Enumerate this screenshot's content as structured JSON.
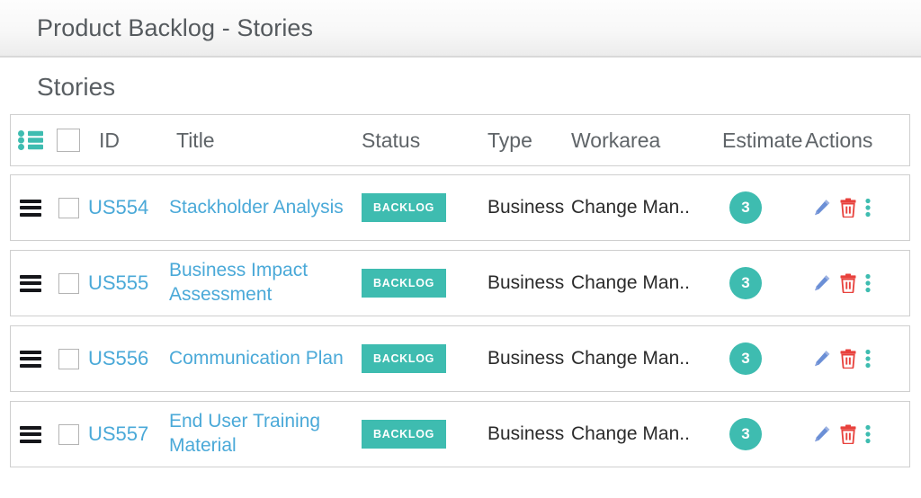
{
  "window": {
    "title": "Product Backlog - Stories"
  },
  "page": {
    "heading": "Stories"
  },
  "icons": {
    "list_icon": "list-icon",
    "drag_handle": "drag-handle-icon",
    "checkbox": "checkbox-icon",
    "edit": "pencil-icon",
    "delete": "trash-icon",
    "more": "more-vertical-icon"
  },
  "colors": {
    "accent_teal": "#3ebcb0",
    "link_blue": "#4aa9d8",
    "delete_red": "#e8413c",
    "edit_blue": "#6b8fd6",
    "header_text": "#5f6468",
    "border": "#cfcfcf"
  },
  "table": {
    "columns": {
      "id": "ID",
      "title": "Title",
      "status": "Status",
      "type": "Type",
      "workarea": "Workarea",
      "estimate": "Estimate",
      "actions": "Actions"
    },
    "select_all_checked": false,
    "rows": [
      {
        "id": "US554",
        "title": "Stackholder Analysis",
        "status": "BACKLOG",
        "type": "Business",
        "workarea": "Change Man..",
        "estimate": "3",
        "checked": false
      },
      {
        "id": "US555",
        "title": "Business Impact Assessment",
        "status": "BACKLOG",
        "type": "Business",
        "workarea": "Change Man..",
        "estimate": "3",
        "checked": false
      },
      {
        "id": "US556",
        "title": "Communication Plan",
        "status": "BACKLOG",
        "type": "Business",
        "workarea": "Change Man..",
        "estimate": "3",
        "checked": false
      },
      {
        "id": "US557",
        "title": "End User Training Material",
        "status": "BACKLOG",
        "type": "Business",
        "workarea": "Change Man..",
        "estimate": "3",
        "checked": false
      }
    ]
  }
}
